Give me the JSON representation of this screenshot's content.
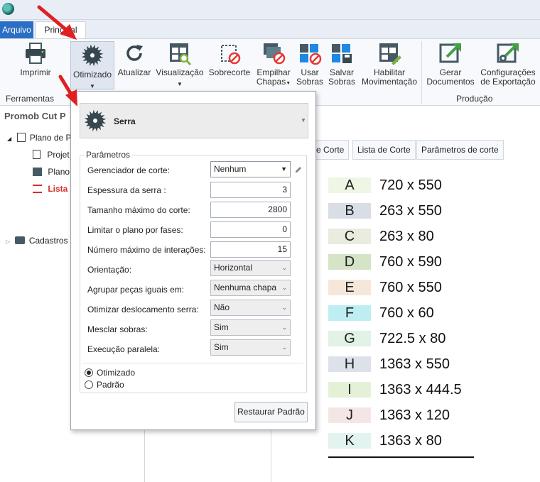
{
  "ribbon": {
    "tabs": [
      {
        "label": "Arquivo"
      },
      {
        "label": "Principal"
      }
    ],
    "buttons": {
      "imprimir": "Imprimir",
      "otimizado": "Otimizado",
      "atualizar": "Atualizar",
      "visualizacao": "Visualização",
      "sobrecorte": "Sobrecorte",
      "empilhar_l1": "Empilhar",
      "empilhar_l2": "Chapas",
      "usar_l1": "Usar",
      "usar_l2": "Sobras",
      "salvar_l1": "Salvar",
      "salvar_l2": "Sobras",
      "habilitar_l1": "Habilitar",
      "habilitar_l2": "Movimentação",
      "gerar_l1": "Gerar",
      "gerar_l2": "Documentos",
      "config_l1": "Configurações",
      "config_l2": "de Exportação"
    },
    "groups": {
      "ferramentas": "Ferramentas",
      "producao": "Produção"
    }
  },
  "left_pane": {
    "title": "Promob Cut P",
    "tree": [
      {
        "label": "Plano de P"
      },
      {
        "label": "Projet"
      },
      {
        "label": "Plano c"
      },
      {
        "label": "Lista c"
      },
      {
        "label": "Cadastros"
      }
    ]
  },
  "right_tabs": [
    "e Corte",
    "Lista de Corte",
    "Parâmetros de corte"
  ],
  "legend": [
    {
      "letter": "A",
      "value": "720 x 550",
      "color": "#eef7e6"
    },
    {
      "letter": "B",
      "value": "263 x 550",
      "color": "#d9dde5"
    },
    {
      "letter": "C",
      "value": "263 x 80",
      "color": "#e9ecde"
    },
    {
      "letter": "D",
      "value": "760 x 590",
      "color": "#d5e3c6"
    },
    {
      "letter": "E",
      "value": "760 x 550",
      "color": "#f6e7da"
    },
    {
      "letter": "F",
      "value": "760 x 60",
      "color": "#bfeef2"
    },
    {
      "letter": "G",
      "value": "722.5 x 80",
      "color": "#e1f2e6"
    },
    {
      "letter": "H",
      "value": "1363 x 550",
      "color": "#dde1ea"
    },
    {
      "letter": "I",
      "value": "1363 x 444.5",
      "color": "#e4f1d6"
    },
    {
      "letter": "J",
      "value": "1363 x 120",
      "color": "#f5e6e6"
    },
    {
      "letter": "K",
      "value": "1363 x 80",
      "color": "#e3f3ef"
    }
  ],
  "panel": {
    "header": "Serra",
    "params_title": "Parâmetros",
    "params": [
      {
        "label": "Gerenciador de corte:",
        "value": "Nenhum"
      },
      {
        "label": "Espessura da serra :",
        "value": "3"
      },
      {
        "label": "Tamanho máximo do corte:",
        "value": "2800"
      },
      {
        "label": "Limitar o plano por fases:",
        "value": "0"
      },
      {
        "label": "Número máximo de interações:",
        "value": "15"
      },
      {
        "label": "Orientação:",
        "value": "Horizontal"
      },
      {
        "label": "Agrupar peças iguais em:",
        "value": "Nenhuma chapa"
      },
      {
        "label": "Otimizar deslocamento serra:",
        "value": "Não"
      },
      {
        "label": "Mesclar sobras:",
        "value": "Sim"
      },
      {
        "label": "Execução paralela:",
        "value": "Sim"
      }
    ],
    "radio_options": [
      "Otimizado",
      "Padrão"
    ],
    "selected_radio": "Otimizado",
    "restore_button": "Restaurar Padrão"
  },
  "colors": {
    "accent": "#2b6fc4",
    "arrow": "#e02020"
  },
  "icons": [
    "app-logo-icon",
    "printer-icon",
    "saw-blade-icon",
    "refresh-icon",
    "view-icon",
    "overcut-icon",
    "stack-sheets-icon",
    "use-scraps-icon",
    "save-scraps-icon",
    "enable-movement-icon",
    "generate-documents-icon",
    "export-settings-icon",
    "pencil-icon",
    "document-icon",
    "sheet-plan-icon",
    "list-icon",
    "folder-icon",
    "caret-icon"
  ]
}
